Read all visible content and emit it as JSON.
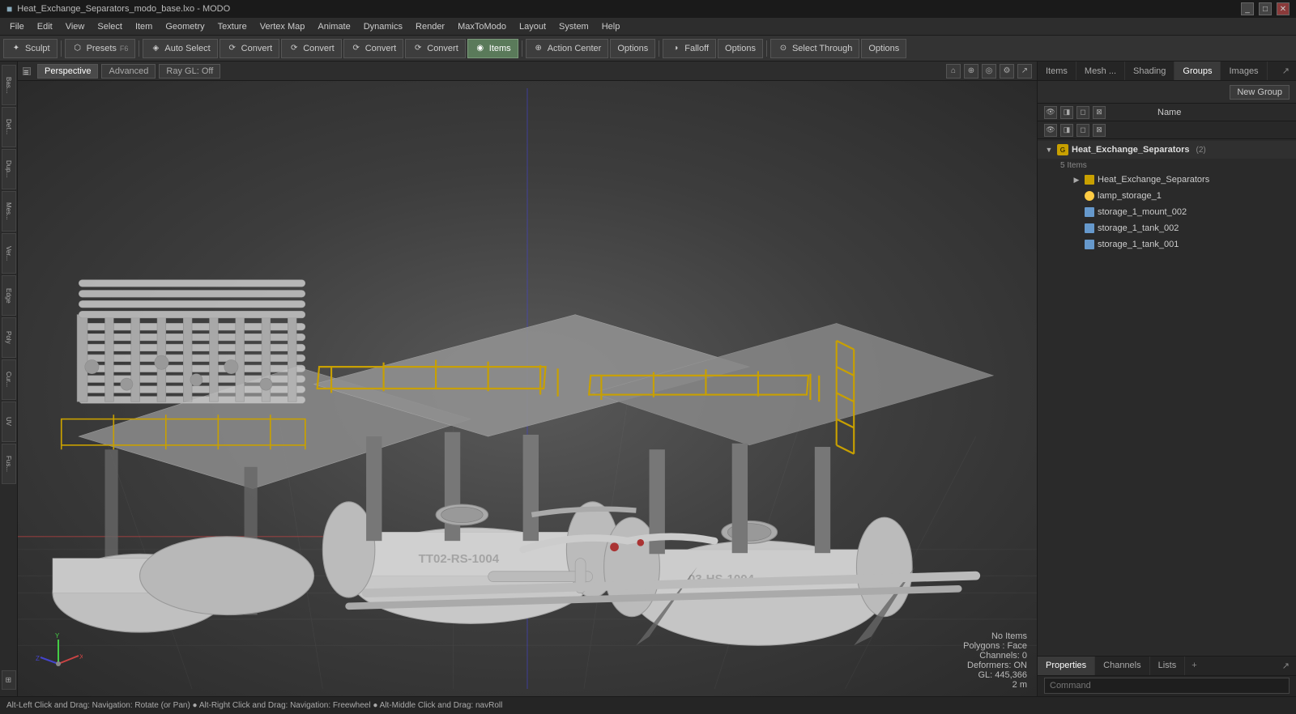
{
  "titlebar": {
    "title": "Heat_Exchange_Separators_modo_base.lxo - MODO",
    "controls": [
      "_",
      "□",
      "×"
    ]
  },
  "menubar": {
    "items": [
      "File",
      "Edit",
      "View",
      "Select",
      "Item",
      "Geometry",
      "Texture",
      "Vertex Map",
      "Animate",
      "Dynamics",
      "Render",
      "MaxToModo",
      "Layout",
      "System",
      "Help"
    ]
  },
  "toolbar": {
    "sculpt_label": "Sculpt",
    "presets_label": "Presets",
    "presets_key": "F6",
    "auto_select_label": "Auto Select",
    "convert_labels": [
      "Convert",
      "Convert",
      "Convert",
      "Convert"
    ],
    "items_label": "Items",
    "action_center_label": "Action Center",
    "options_label1": "Options",
    "falloff_label": "Falloff",
    "options_label2": "Options",
    "select_through_label": "Select Through",
    "options_label3": "Options"
  },
  "viewport": {
    "tabs": [
      "Perspective",
      "Advanced"
    ],
    "ray_gl": "Ray GL: Off",
    "info": {
      "no_items": "No Items",
      "polygons": "Polygons : Face",
      "channels": "Channels: 0",
      "deformers": "Deformers: ON",
      "gl_coords": "GL: 445,366",
      "scale": "2 m"
    }
  },
  "right_panel": {
    "tabs": [
      "Items",
      "Mesh ...",
      "Shading",
      "Groups",
      "Images"
    ],
    "active_tab": "Groups",
    "groups": {
      "new_group_label": "New Group",
      "name_header": "Name",
      "tree": {
        "group_name": "Heat_Exchange_Separators",
        "group_count": "(2)",
        "sub_label": "5 Items",
        "items": [
          {
            "name": "Heat_Exchange_Separators",
            "type": "group"
          },
          {
            "name": "lamp_storage_1",
            "type": "lamp"
          },
          {
            "name": "storage_1_mount_002",
            "type": "mesh"
          },
          {
            "name": "storage_1_tank_002",
            "type": "mesh"
          },
          {
            "name": "storage_1_tank_001",
            "type": "mesh"
          }
        ]
      }
    }
  },
  "bottom_panel": {
    "tabs": [
      "Properties",
      "Channels",
      "Lists",
      "+"
    ],
    "active_tab": "Properties",
    "command_label": "Command",
    "command_placeholder": "Command"
  },
  "left_sidebar": {
    "tabs": [
      "Bas...",
      "Def...",
      "Duplic...",
      "Mesh ...",
      "Vertex",
      "Edge",
      "Poly",
      "Curve",
      "UV",
      "Fusion"
    ]
  },
  "statusbar": {
    "text": "Alt-Left Click and Drag: Navigation: Rotate (or Pan) ● Alt-Right Click and Drag: Navigation: Freewheel ● Alt-Middle Click and Drag: navRoll"
  }
}
